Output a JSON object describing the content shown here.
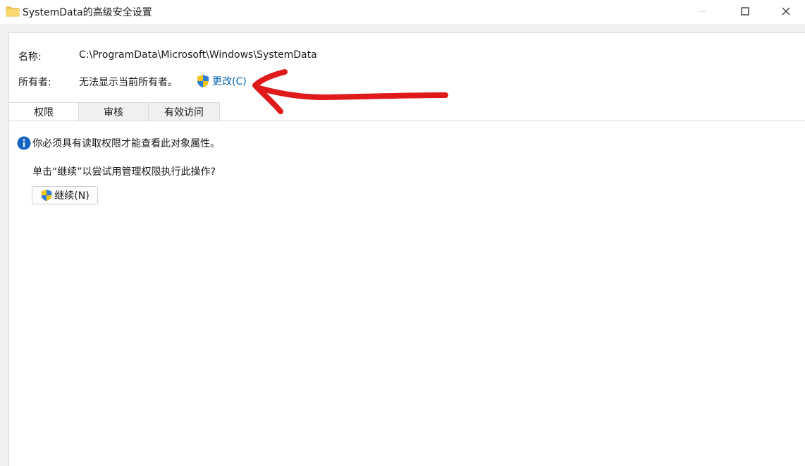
{
  "window": {
    "title": "SystemData的高级安全设置",
    "icon": "folder-icon",
    "controls": {
      "minimize": "minimize-icon",
      "maximize": "maximize-icon",
      "close": "close-icon"
    }
  },
  "fields": {
    "name_label": "名称:",
    "name_value": "C:\\ProgramData\\Microsoft\\Windows\\SystemData",
    "owner_label": "所有者:",
    "owner_value": "无法显示当前所有者。",
    "change_link": "更改(C)"
  },
  "tabs": [
    {
      "label": "权限",
      "active": true
    },
    {
      "label": "审核",
      "active": false
    },
    {
      "label": "有效访问",
      "active": false
    }
  ],
  "permissions": {
    "info_message": "你必须具有读取权限才能查看此对象属性。",
    "prompt": "单击“继续”以尝试用管理权限执行此操作?",
    "continue_button": "继续(N)"
  },
  "colors": {
    "link": "#0063b1",
    "info_icon": "#1565c0",
    "annotation": "#e0191b",
    "folder": "#f8c94b"
  },
  "icons": {
    "shield": "uac-shield-icon",
    "info": "info-icon",
    "annotation": "red-arrow-annotation"
  }
}
